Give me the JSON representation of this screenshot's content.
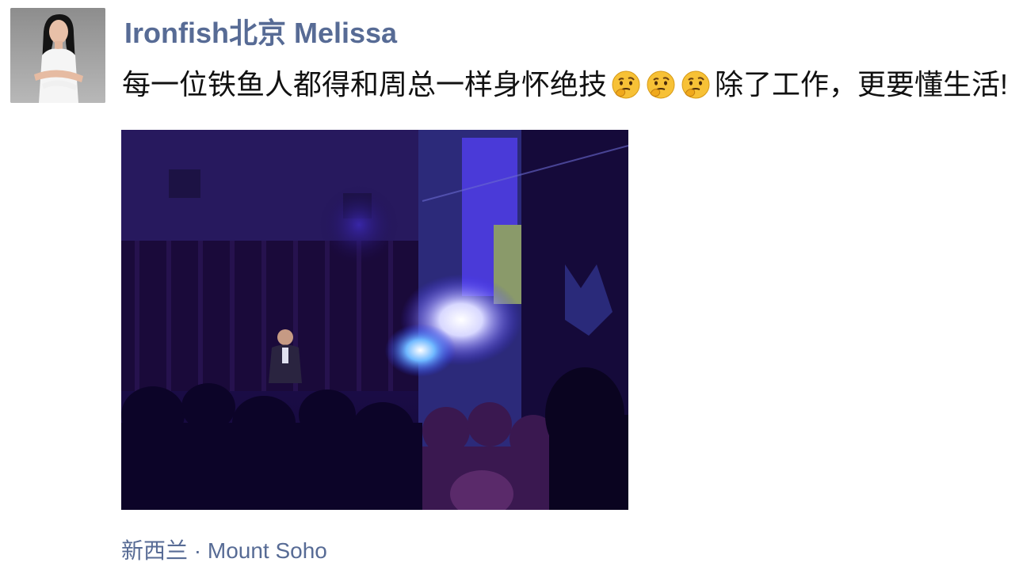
{
  "post": {
    "author": "Ironfish北京 Melissa",
    "text_before": "每一位铁鱼人都得和周总一样身怀绝技",
    "emoji": [
      "thinking-face-icon",
      "thinking-face-icon",
      "thinking-face-icon"
    ],
    "text_after": "除了工作，更要懂生活!",
    "location": "新西兰 · Mount Soho"
  },
  "colors": {
    "author_name": "#576b95",
    "location": "#576b95",
    "body_text": "#111111"
  }
}
